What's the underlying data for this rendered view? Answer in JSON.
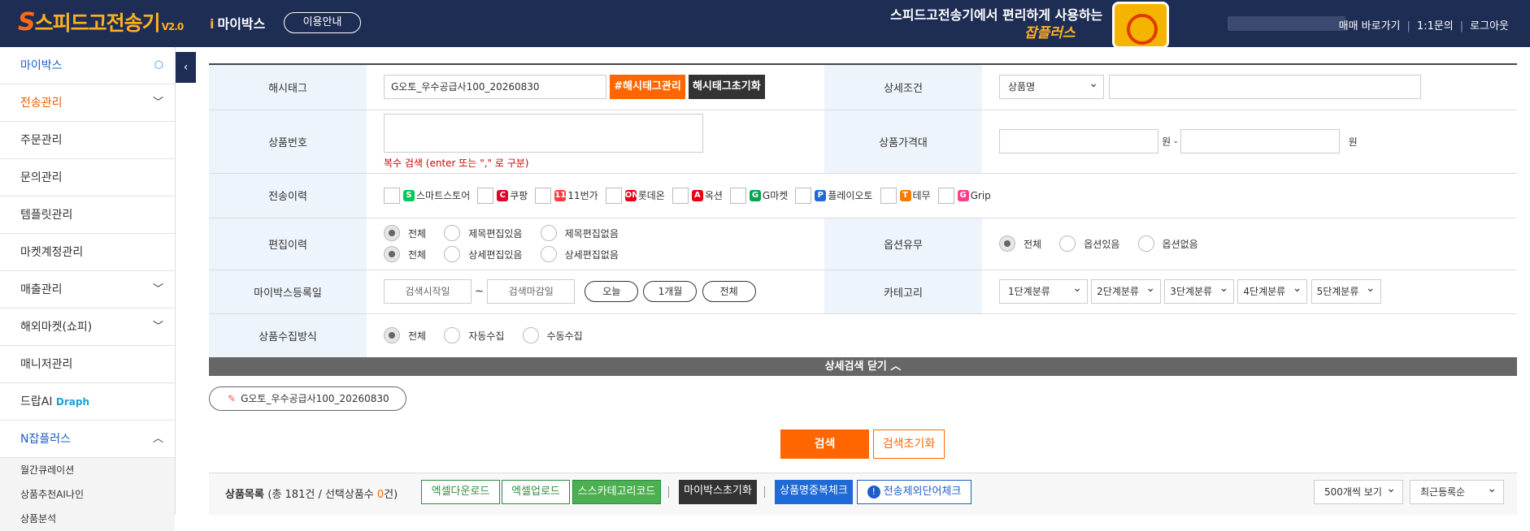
{
  "header": {
    "logo_text": "스피드고전송기",
    "logo_version": "V2.0",
    "mybox_label": "마이박스",
    "guide_button": "이용안내",
    "promo_line1": "스피드고전송기에서 편리하게 사용하는",
    "promo_line2": "잡플러스",
    "links": [
      "매매 바로가기",
      "1:1문의",
      "로그아웃"
    ]
  },
  "sidebar": {
    "items": [
      {
        "label": "마이박스"
      },
      {
        "label": "전송관리"
      },
      {
        "label": "주문관리"
      },
      {
        "label": "문의관리"
      },
      {
        "label": "템플릿관리"
      },
      {
        "label": "마켓계정관리"
      },
      {
        "label": "매출관리"
      },
      {
        "label": "해외마켓(쇼피)"
      },
      {
        "label": "매니저관리"
      },
      {
        "label": "드랍AI",
        "extra": "Draph"
      },
      {
        "label": "N잡플러스"
      }
    ],
    "subitems": [
      "월간큐레이션",
      "상품추천AI나인",
      "상품분석"
    ]
  },
  "form": {
    "hashtag_label": "해시태그",
    "hashtag_value": "G오토_우수공급사100_20260830",
    "hashtag_manage": "#해시태그관리",
    "hashtag_reset": "해시태그초기화",
    "detail_cond_label": "상세조건",
    "detail_cond_select": "상품명",
    "product_no_label": "상품번호",
    "product_no_hint": "복수 검색 (enter 또는 \",\" 로 구분)",
    "price_label": "상품가격대",
    "won": "원",
    "won_dash": "원 -",
    "history_label": "전송이력",
    "markets": [
      {
        "name": "스마트스토어",
        "color": "#03c75a",
        "icon": "S"
      },
      {
        "name": "쿠팡",
        "color": "#e4002b",
        "icon": "C"
      },
      {
        "name": "11번가",
        "color": "#ff3c3c",
        "icon": "11"
      },
      {
        "name": "롯데온",
        "color": "#e60012",
        "icon": "ON"
      },
      {
        "name": "옥션",
        "color": "#e60012",
        "icon": "A"
      },
      {
        "name": "G마켓",
        "color": "#00a650",
        "icon": "G"
      },
      {
        "name": "플레이오토",
        "color": "#1e6ad6",
        "icon": "P"
      },
      {
        "name": "테무",
        "color": "#f07c00",
        "icon": "T"
      },
      {
        "name": "Grip",
        "color": "#ff3c8e",
        "icon": "G"
      }
    ],
    "edit_label": "편집이력",
    "edit_row1": [
      "전체",
      "제목편집있음",
      "제목편집없음"
    ],
    "edit_row2": [
      "전체",
      "상세편집있음",
      "상세편집없음"
    ],
    "option_label": "옵션유무",
    "option_row": [
      "전체",
      "옵션있음",
      "옵션없음"
    ],
    "regdate_label": "마이박스등록일",
    "date_start": "검색시작일",
    "date_end": "검색마감일",
    "date_sep": "~",
    "date_pills": [
      "오늘",
      "1개월",
      "전체"
    ],
    "category_label": "카테고리",
    "categories": [
      "1단계분류",
      "2단계분류",
      "3단계분류",
      "4단계분류",
      "5단계분류"
    ],
    "collect_label": "상품수집방식",
    "collect_row": [
      "전체",
      "자동수집",
      "수동수집"
    ]
  },
  "close_detail": "상세검색 닫기",
  "tag_pill": "G오토_우수공급사100_20260830",
  "search_button": "검색",
  "search_reset": "검색초기화",
  "listbar": {
    "title": "상품목록",
    "count_prefix": "(총 181건 / 선택상품수 ",
    "count_zero": "0",
    "count_suffix": "건)",
    "buttons": [
      "엑셀다운로드",
      "엑셀업로드",
      "스스카테고리코드",
      "마이박스초기화",
      "상품명중복체크",
      "전송제외단어체크"
    ],
    "view_select": "500개씩 보기",
    "sort_select": "최근등록순"
  }
}
